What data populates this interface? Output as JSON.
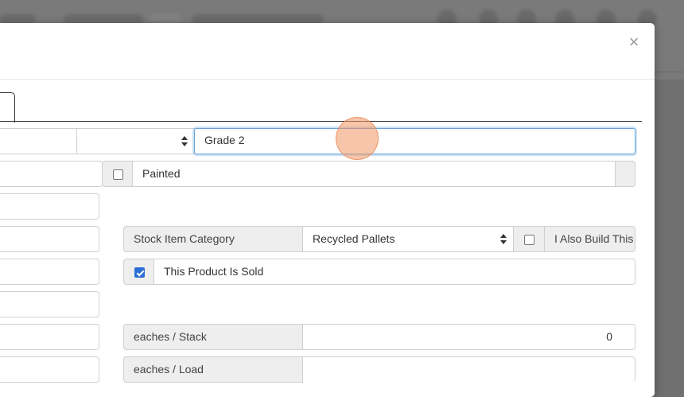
{
  "modal": {
    "close_glyph": "×"
  },
  "form": {
    "grade_value": "Grade 2",
    "painted_label": "Painted",
    "painted_checked": false,
    "stock_category_label": "Stock Item Category",
    "stock_category_value": "Recycled Pallets",
    "also_build_label": "I Also Build This",
    "also_build_checked": false,
    "sold_label": "This Product Is Sold",
    "sold_checked": true,
    "eaches_stack_label": "eaches / Stack",
    "eaches_stack_value": "0",
    "eaches_load_label": "eaches / Load",
    "eaches_load_value": ""
  },
  "colors": {
    "focus_border": "#6aa2d6",
    "checkbox_checked": "#2b6fd6",
    "addon_bg": "#eeeeee"
  }
}
